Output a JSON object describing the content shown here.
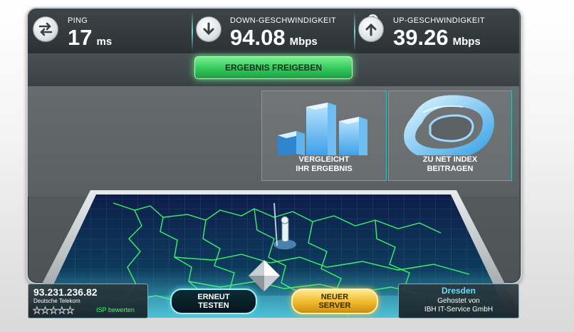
{
  "metrics": {
    "ping": {
      "label": "PING",
      "value": "17",
      "unit": "ms"
    },
    "download": {
      "label": "DOWN-GESCHWINDIGKEIT",
      "value": "94.08",
      "unit": "Mbps"
    },
    "upload": {
      "label": "UP-GESCHWINDIGKEIT",
      "value": "39.26",
      "unit": "Mbps"
    }
  },
  "share": {
    "label": "ERGEBNIS FREIGEBEN"
  },
  "tiles": {
    "compare": {
      "line1": "VERGLEICHT",
      "line2": "IHR ERGEBNIS"
    },
    "netindex": {
      "line1": "ZU NET INDEX",
      "line2": "BEITRAGEN"
    }
  },
  "client": {
    "ip": "93.231.236.82",
    "isp": "Deutsche Telekom",
    "rate_label": "ISP bewerten",
    "stars_total": 5,
    "stars_filled": 0
  },
  "actions": {
    "retest": {
      "line1": "ERNEUT",
      "line2": "TESTEN"
    },
    "new_server": {
      "line1": "NEUER",
      "line2": "SERVER"
    }
  },
  "server": {
    "city": "Dresden",
    "hosted_by": "Gehostet von",
    "host": "IBH IT-Service GmbH"
  },
  "icons": {
    "ping": "swap-arrows-icon",
    "download": "arrow-down-icon",
    "upload": "arrow-up-icon",
    "info": "info-icon",
    "compare": "bar-chart-icon",
    "netindex": "net-index-icon",
    "map_pin": "location-pin-icon"
  },
  "colors": {
    "accent_teal": "#3fd0c8",
    "share_green": "#32c95a",
    "gold": "#f0b82d",
    "map_green": "#3cff6a"
  }
}
